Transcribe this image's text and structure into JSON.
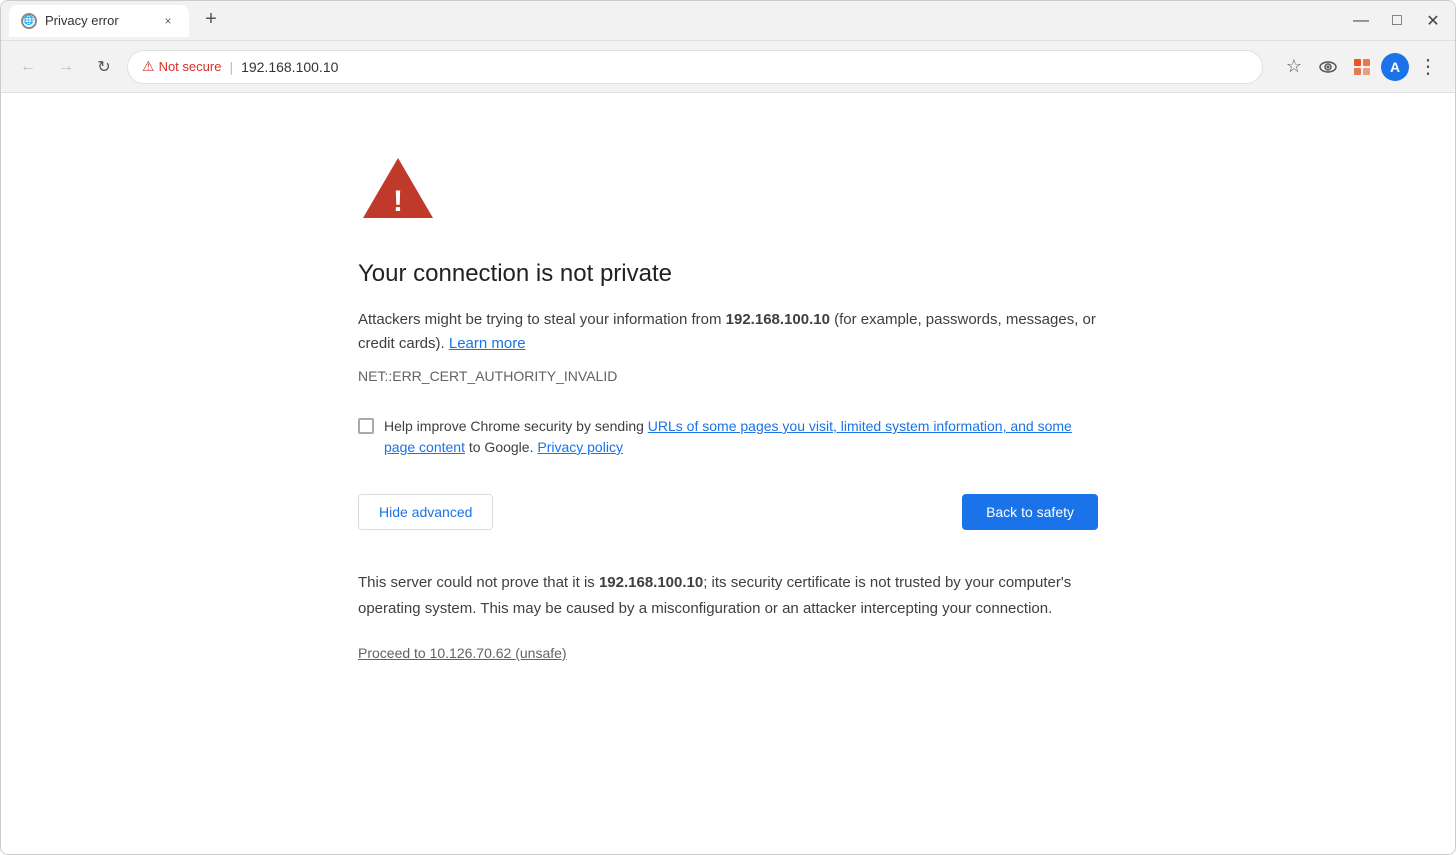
{
  "window": {
    "title": "Privacy error"
  },
  "tab": {
    "favicon": "🌐",
    "title": "Privacy error",
    "close": "×"
  },
  "tab_new": "+",
  "window_controls": {
    "minimize": "—",
    "maximize": "□",
    "close": "✕"
  },
  "nav": {
    "back": "←",
    "forward": "→",
    "reload": "↻"
  },
  "address_bar": {
    "not_secure_label": "Not secure",
    "separator": "|",
    "url": "192.168.100.10"
  },
  "toolbar": {
    "bookmark": "☆",
    "extension1": "👁",
    "extension2": "🧩",
    "profile_letter": "A",
    "menu": "⋮"
  },
  "page": {
    "heading": "Your connection is not private",
    "description_prefix": "Attackers might be trying to steal your information from ",
    "description_domain": "192.168.100.10",
    "description_suffix": " (for example, passwords, messages, or credit cards).",
    "learn_more": "Learn more",
    "error_code": "NET::ERR_CERT_AUTHORITY_INVALID",
    "checkbox_label_prefix": "Help improve Chrome security by sending ",
    "checkbox_link": "URLs of some pages you visit, limited system information, and some page content",
    "checkbox_label_suffix": " to Google.",
    "privacy_policy": "Privacy policy",
    "btn_hide_advanced": "Hide advanced",
    "btn_back_safety": "Back to safety",
    "advanced_text_prefix": "This server could not prove that it is ",
    "advanced_text_domain": "192.168.100.10",
    "advanced_text_suffix": "; its security certificate is not trusted by your computer's operating system. This may be caused by a misconfiguration or an attacker intercepting your connection.",
    "proceed_link": "Proceed to 10.126.70.62 (unsafe)"
  }
}
